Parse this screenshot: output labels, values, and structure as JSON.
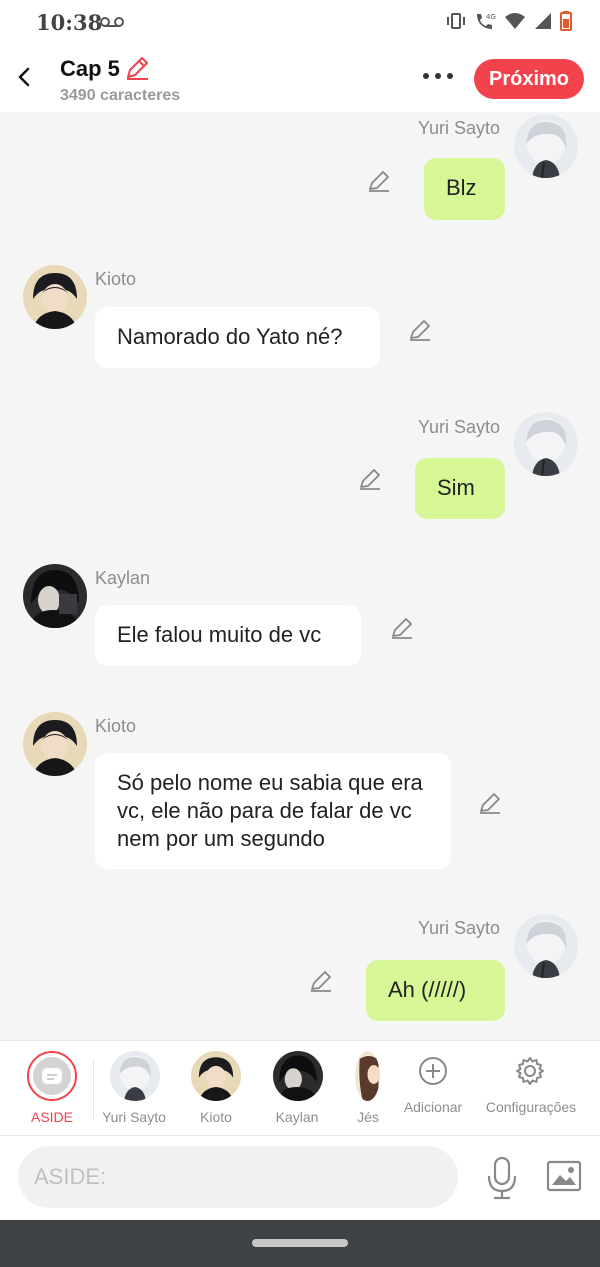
{
  "status_bar": {
    "time": "10:38"
  },
  "header": {
    "title": "Cap 5",
    "subtitle": "3490 caracteres",
    "next_label": "Próximo"
  },
  "messages": [
    {
      "side": "right",
      "name": "Yuri Sayto",
      "text": "Blz"
    },
    {
      "side": "left",
      "name": "Kioto",
      "text": "Namorado do Yato né?"
    },
    {
      "side": "right",
      "name": "Yuri Sayto",
      "text": "Sim"
    },
    {
      "side": "left",
      "name": "Kaylan",
      "text": "Ele falou muito de vc"
    },
    {
      "side": "left",
      "name": "Kioto",
      "text": "Só pelo nome eu sabia que era vc, ele não para de falar de vc nem por um segundo"
    },
    {
      "side": "right",
      "name": "Yuri Sayto",
      "text": "Ah (/////)"
    }
  ],
  "character_bar": {
    "aside_label": "ASIDE",
    "characters": [
      "Yuri Sayto",
      "Kioto",
      "Kaylan",
      "Jés"
    ],
    "add_label": "Adicionar",
    "settings_label": "Configurações"
  },
  "input": {
    "placeholder": "ASIDE:"
  },
  "colors": {
    "accent": "#f2424b",
    "bubble_right": "#d7f797",
    "bubble_left": "#ffffff",
    "background": "#f5f5f5"
  }
}
